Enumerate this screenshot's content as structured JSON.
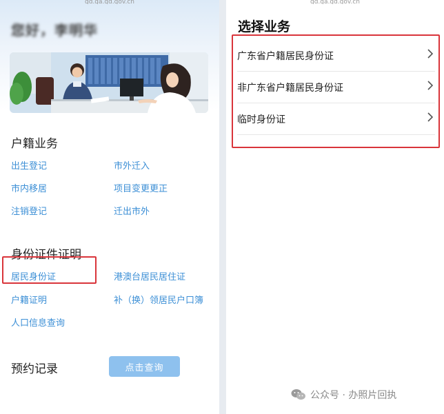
{
  "left": {
    "url": "gd.ga.gd.gov.cn",
    "greeting": "您好，李明华",
    "household": {
      "title": "户籍业务",
      "links": [
        "出生登记",
        "市外迁入",
        "市内移居",
        "项目变更更正",
        "注销登记",
        "迁出市外"
      ]
    },
    "idcert": {
      "title": "身份证件证明",
      "links": [
        "居民身份证",
        "港澳台居民居住证",
        "户籍证明",
        "补（换）领居民户口簿",
        "人口信息查询"
      ]
    },
    "appointment": {
      "title": "预约记录",
      "button": "点击查询"
    },
    "colors": {
      "link": "#3c8fd6",
      "button": "#8ec1ee",
      "highlight": "#d9343a"
    }
  },
  "right": {
    "url": "gd.ga.gd.gov.cn",
    "title": "选择业务",
    "items": [
      "广东省户籍居民身份证",
      "非广东省户籍居民身份证",
      "临时身份证"
    ],
    "chevron_icon": "chevron-right-icon"
  },
  "watermark": {
    "text": "公众号 · 办照片回执",
    "icon": "wechat-icon"
  }
}
